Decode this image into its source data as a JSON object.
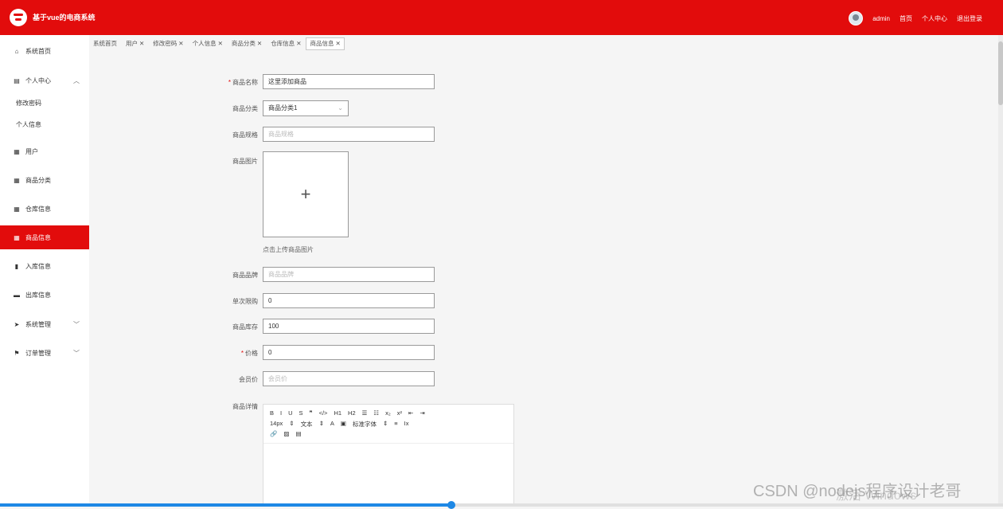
{
  "header": {
    "app_title": "基于vue的电商系统",
    "user": "admin",
    "links": [
      "首页",
      "个人中心",
      "退出登录"
    ]
  },
  "sidebar": {
    "items": [
      {
        "label": "系统首页",
        "icon": "home-icon"
      },
      {
        "label": "个人中心",
        "icon": "profile-icon",
        "expanded": true
      },
      {
        "label": "用户",
        "icon": "grid-icon"
      },
      {
        "label": "商品分类",
        "icon": "grid-icon"
      },
      {
        "label": "仓库信息",
        "icon": "grid-icon"
      },
      {
        "label": "商品信息",
        "icon": "grid-icon",
        "active": true
      },
      {
        "label": "入库信息",
        "icon": "clipboard-icon"
      },
      {
        "label": "出库信息",
        "icon": "ticket-icon"
      },
      {
        "label": "系统管理",
        "icon": "send-icon"
      },
      {
        "label": "订单管理",
        "icon": "flag-icon"
      }
    ],
    "subitems": [
      "修改密码",
      "个人信息"
    ]
  },
  "tabs": [
    {
      "label": "系统首页",
      "closable": false
    },
    {
      "label": "用户",
      "closable": true
    },
    {
      "label": "修改密码",
      "closable": true
    },
    {
      "label": "个人信息",
      "closable": true
    },
    {
      "label": "商品分类",
      "closable": true
    },
    {
      "label": "仓库信息",
      "closable": true
    },
    {
      "label": "商品信息",
      "closable": true,
      "active": true
    }
  ],
  "form": {
    "name_label": "商品名称",
    "name_value": "这里添加商品",
    "category_label": "商品分类",
    "category_value": "商品分类1",
    "spec_label": "商品规格",
    "spec_placeholder": "商品规格",
    "image_label": "商品图片",
    "upload_hint": "点击上传商品图片",
    "brand_label": "商品品牌",
    "brand_placeholder": "商品品牌",
    "limit_label": "单次限购",
    "limit_value": "0",
    "stock_label": "商品库存",
    "stock_value": "100",
    "price_label": "价格",
    "price_value": "0",
    "member_price_label": "会员价",
    "member_price_placeholder": "会员价",
    "detail_label": "商品详情"
  },
  "editor": {
    "row1": [
      "B",
      "I",
      "U",
      "S",
      "❞",
      "</>",
      "H1",
      "H2",
      "☰",
      "☷",
      "x₂",
      "x²",
      "⇤",
      "⇥"
    ],
    "row2": [
      "14px",
      "⇕",
      "文本",
      "⇕",
      "A",
      "▣",
      "标准字体",
      "⇕",
      "≡",
      "Ix"
    ],
    "row3": [
      "🔗",
      "▨",
      "▤"
    ]
  },
  "watermark": "CSDN @nodejs程序设计老哥",
  "windows_note": "激活 Windows",
  "progress": 0.45
}
